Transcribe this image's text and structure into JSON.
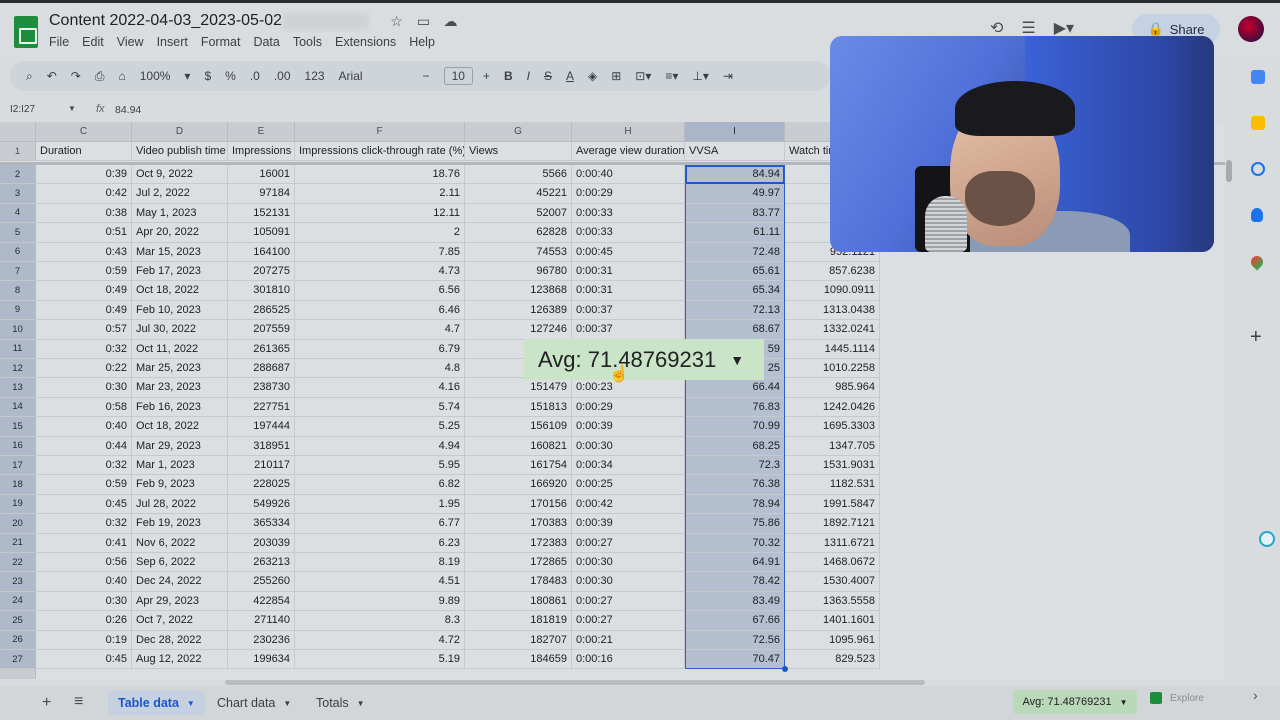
{
  "doc": {
    "title": "Content 2022-04-03_2023-05-02"
  },
  "menu": [
    "File",
    "Edit",
    "View",
    "Insert",
    "Format",
    "Data",
    "Tools",
    "Extensions",
    "Help"
  ],
  "toolbar": {
    "zoom": "100%",
    "currency": "$",
    "percent": "%",
    "dec_less": ".0",
    "dec_more": ".00",
    "format_num": "123",
    "font": "Arial",
    "font_size": "10"
  },
  "header": {
    "share_label": "Share"
  },
  "formula": {
    "cell_ref": "I2:I27",
    "value": "84.94"
  },
  "columns": [
    "C",
    "D",
    "E",
    "F",
    "G",
    "H",
    "I"
  ],
  "headers": [
    "Duration",
    "Video publish time",
    "Impressions",
    "Impressions click-through rate (%)",
    "Views",
    "Average view duration",
    "VVSA",
    "Watch tim"
  ],
  "rows": [
    {
      "n": "2",
      "c": "0:39",
      "d": "Oct 9, 2022",
      "e": "16001",
      "f": "18.76",
      "g": "5566",
      "h": "0:00:40",
      "i": "84.94",
      "j": ""
    },
    {
      "n": "3",
      "c": "0:42",
      "d": "Jul 2, 2022",
      "e": "97184",
      "f": "2.11",
      "g": "45221",
      "h": "0:00:29",
      "i": "49.97",
      "j": ""
    },
    {
      "n": "4",
      "c": "0:38",
      "d": "May 1, 2023",
      "e": "152131",
      "f": "12.11",
      "g": "52007",
      "h": "0:00:33",
      "i": "83.77",
      "j": ""
    },
    {
      "n": "5",
      "c": "0:51",
      "d": "Apr 20, 2022",
      "e": "105091",
      "f": "2",
      "g": "62828",
      "h": "0:00:33",
      "i": "61.11",
      "j": ""
    },
    {
      "n": "6",
      "c": "0:43",
      "d": "Mar 15, 2023",
      "e": "164100",
      "f": "7.85",
      "g": "74553",
      "h": "0:00:45",
      "i": "72.48",
      "j": "952.1121"
    },
    {
      "n": "7",
      "c": "0:59",
      "d": "Feb 17, 2023",
      "e": "207275",
      "f": "4.73",
      "g": "96780",
      "h": "0:00:31",
      "i": "65.61",
      "j": "857.6238"
    },
    {
      "n": "8",
      "c": "0:49",
      "d": "Oct 18, 2022",
      "e": "301810",
      "f": "6.56",
      "g": "123868",
      "h": "0:00:31",
      "i": "65.34",
      "j": "1090.0911"
    },
    {
      "n": "9",
      "c": "0:49",
      "d": "Feb 10, 2023",
      "e": "286525",
      "f": "6.46",
      "g": "126389",
      "h": "0:00:37",
      "i": "72.13",
      "j": "1313.0438"
    },
    {
      "n": "10",
      "c": "0:57",
      "d": "Jul 30, 2022",
      "e": "207559",
      "f": "4.7",
      "g": "127246",
      "h": "0:00:37",
      "i": "68.67",
      "j": "1332.0241"
    },
    {
      "n": "11",
      "c": "0:32",
      "d": "Oct 11, 2022",
      "e": "261365",
      "f": "6.79",
      "g": "",
      "h": "",
      "i": "59",
      "j": "1445.1114"
    },
    {
      "n": "12",
      "c": "0:22",
      "d": "Mar 25, 2023",
      "e": "288687",
      "f": "4.8",
      "g": "",
      "h": "",
      "i": "25",
      "j": "1010.2258"
    },
    {
      "n": "13",
      "c": "0:30",
      "d": "Mar 23, 2023",
      "e": "238730",
      "f": "4.16",
      "g": "151479",
      "h": "0:00:23",
      "i": "66.44",
      "j": "985.964"
    },
    {
      "n": "14",
      "c": "0:58",
      "d": "Feb 16, 2023",
      "e": "227751",
      "f": "5.74",
      "g": "151813",
      "h": "0:00:29",
      "i": "76.83",
      "j": "1242.0426"
    },
    {
      "n": "15",
      "c": "0:40",
      "d": "Oct 18, 2022",
      "e": "197444",
      "f": "5.25",
      "g": "156109",
      "h": "0:00:39",
      "i": "70.99",
      "j": "1695.3303"
    },
    {
      "n": "16",
      "c": "0:44",
      "d": "Mar 29, 2023",
      "e": "318951",
      "f": "4.94",
      "g": "160821",
      "h": "0:00:30",
      "i": "68.25",
      "j": "1347.705"
    },
    {
      "n": "17",
      "c": "0:32",
      "d": "Mar 1, 2023",
      "e": "210117",
      "f": "5.95",
      "g": "161754",
      "h": "0:00:34",
      "i": "72.3",
      "j": "1531.9031"
    },
    {
      "n": "18",
      "c": "0:59",
      "d": "Feb 9, 2023",
      "e": "228025",
      "f": "6.82",
      "g": "166920",
      "h": "0:00:25",
      "i": "76.38",
      "j": "1182.531"
    },
    {
      "n": "19",
      "c": "0:45",
      "d": "Jul 28, 2022",
      "e": "549926",
      "f": "1.95",
      "g": "170156",
      "h": "0:00:42",
      "i": "78.94",
      "j": "1991.5847"
    },
    {
      "n": "20",
      "c": "0:32",
      "d": "Feb 19, 2023",
      "e": "365334",
      "f": "6.77",
      "g": "170383",
      "h": "0:00:39",
      "i": "75.86",
      "j": "1892.7121"
    },
    {
      "n": "21",
      "c": "0:41",
      "d": "Nov 6, 2022",
      "e": "203039",
      "f": "6.23",
      "g": "172383",
      "h": "0:00:27",
      "i": "70.32",
      "j": "1311.6721"
    },
    {
      "n": "22",
      "c": "0:56",
      "d": "Sep 6, 2022",
      "e": "263213",
      "f": "8.19",
      "g": "172865",
      "h": "0:00:30",
      "i": "64.91",
      "j": "1468.0672"
    },
    {
      "n": "23",
      "c": "0:40",
      "d": "Dec 24, 2022",
      "e": "255260",
      "f": "4.51",
      "g": "178483",
      "h": "0:00:30",
      "i": "78.42",
      "j": "1530.4007"
    },
    {
      "n": "24",
      "c": "0:30",
      "d": "Apr 29, 2023",
      "e": "422854",
      "f": "9.89",
      "g": "180861",
      "h": "0:00:27",
      "i": "83.49",
      "j": "1363.5558"
    },
    {
      "n": "25",
      "c": "0:26",
      "d": "Oct 7, 2022",
      "e": "271140",
      "f": "8.3",
      "g": "181819",
      "h": "0:00:27",
      "i": "67.66",
      "j": "1401.1601"
    },
    {
      "n": "26",
      "c": "0:19",
      "d": "Dec 28, 2022",
      "e": "230236",
      "f": "4.72",
      "g": "182707",
      "h": "0:00:21",
      "i": "72.56",
      "j": "1095.961"
    },
    {
      "n": "27",
      "c": "0:45",
      "d": "Aug 12, 2022",
      "e": "199634",
      "f": "5.19",
      "g": "184659",
      "h": "0:00:16",
      "i": "70.47",
      "j": "829.523"
    }
  ],
  "popup": {
    "avg_label": "Avg: 71.48769231"
  },
  "sheets": [
    "Table data",
    "Chart data",
    "Totals"
  ],
  "statusbar": {
    "avg": "Avg: 71.48769231",
    "explore": "Explore"
  },
  "colors": {
    "accent": "#1a57c9",
    "selection": "#b4bfd0",
    "avg_popup": "#c9e4c6",
    "sheets_green": "#1e8e3e"
  }
}
